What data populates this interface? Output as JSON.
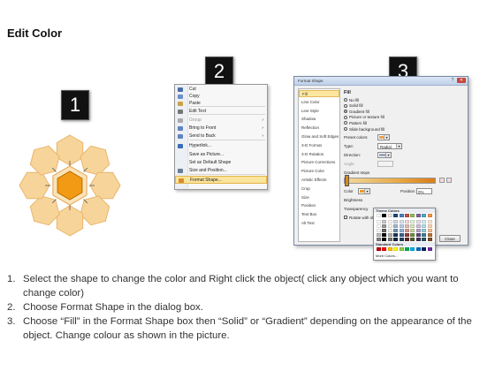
{
  "title": "Edit Color",
  "steps": [
    "1",
    "2",
    "3"
  ],
  "context_menu": {
    "items": [
      {
        "label": "Cut",
        "icon": "scissors-icon",
        "color": "#4a6fa5",
        "disabled": false
      },
      {
        "label": "Copy",
        "icon": "copy-icon",
        "color": "#6b8fc7",
        "disabled": false
      },
      {
        "label": "Paste",
        "icon": "paste-icon",
        "color": "#c9a24b",
        "disabled": false
      },
      {
        "label": "Edit Text",
        "icon": "text-icon",
        "color": "#777777",
        "disabled": false
      },
      {
        "label": "Group",
        "icon": "group-icon",
        "color": "#aaaaaa",
        "disabled": true,
        "arrow": true
      },
      {
        "label": "Bring to Front",
        "icon": "bring-front-icon",
        "color": "#5f83c0",
        "disabled": false,
        "arrow": true
      },
      {
        "label": "Send to Back",
        "icon": "send-back-icon",
        "color": "#5f83c0",
        "disabled": false,
        "arrow": true
      },
      {
        "label": "Hyperlink...",
        "icon": "hyperlink-icon",
        "color": "#3b6db4",
        "disabled": false
      },
      {
        "label": "Save as Picture...",
        "icon": "",
        "color": "",
        "disabled": false
      },
      {
        "label": "Set as Default Shape",
        "icon": "",
        "color": "",
        "disabled": false
      },
      {
        "label": "Size and Position...",
        "icon": "size-icon",
        "color": "#6a7d95",
        "disabled": false
      },
      {
        "label": "Format Shape...",
        "icon": "format-shape-icon",
        "color": "#d88c2a",
        "disabled": false,
        "highlighted": true
      }
    ]
  },
  "dialog": {
    "title": "Format Shape",
    "nav": [
      "Fill",
      "Line Color",
      "Line Style",
      "Shadow",
      "Reflection",
      "Glow and Soft Edges",
      "3-D Format",
      "3-D Rotation",
      "Picture Corrections",
      "Picture Color",
      "Artistic Effects",
      "Crop",
      "Size",
      "Position",
      "Text Box",
      "Alt Text"
    ],
    "section": "Fill",
    "fill_options": [
      "No fill",
      "Solid fill",
      "Gradient fill",
      "Picture or texture fill",
      "Pattern fill",
      "Slide background fill"
    ],
    "selected_fill": "Gradient fill",
    "preset_colors": "Preset colors:",
    "type_label": "Type:",
    "type_value": "Radial",
    "direction_label": "Direction:",
    "angle_label": "Angle:",
    "gradient_stops_label": "Gradient stops",
    "color_label": "Color",
    "position_label": "Position:",
    "position_value": "0%",
    "brightness_label": "Brightness",
    "transparency_label": "Transparency",
    "rotate_label": "Rotate with shape",
    "close_button": "Close",
    "theme_colors_label": "Theme Colors",
    "standard_colors_label": "Standard Colors",
    "more_colors_label": "More Colors...",
    "standard_colors": [
      "#c00000",
      "#ff0000",
      "#ffc000",
      "#ffff00",
      "#92d050",
      "#00b050",
      "#00b0f0",
      "#0070c0",
      "#002060",
      "#7030a0"
    ],
    "theme_base": [
      "#ffffff",
      "#000000",
      "#eeece1",
      "#1f497d",
      "#4f81bd",
      "#c0504d",
      "#9bbb59",
      "#8064a2",
      "#4bacc6",
      "#f79646"
    ]
  },
  "instructions": [
    {
      "num": "1.",
      "text": "Select the shape to change the color and Right click the object( click any object which you want to change color)"
    },
    {
      "num": "2.",
      "text": "Choose Format Shape in the dialog box."
    },
    {
      "num": "3.",
      "text": "Choose “Fill” in the Format Shape box then “Solid” or “Gradient” depending on the appearance of the object. Change colour as shown in the picture."
    }
  ],
  "colors": {
    "center_hexagon": "#f29a14",
    "petal": "#f7d59a",
    "petal_edge": "#e9b46a",
    "menu_highlight": "#fbe49b"
  }
}
